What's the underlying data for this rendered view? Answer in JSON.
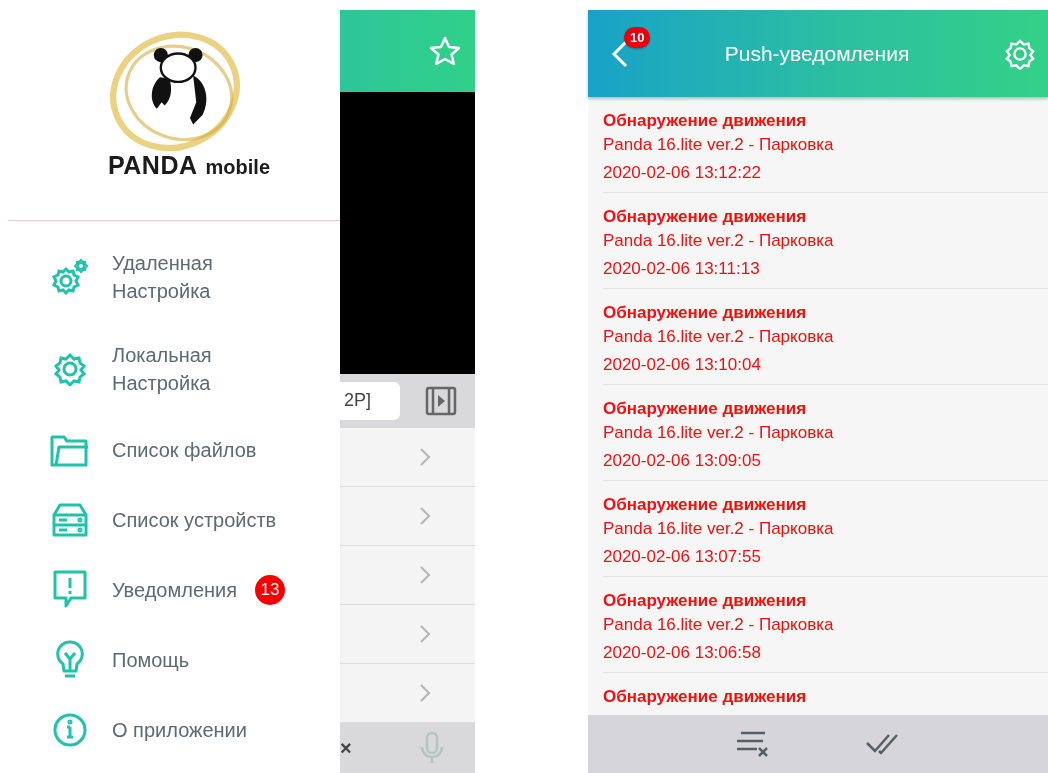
{
  "drawer": {
    "logo": {
      "brand": "PANDA",
      "suffix": "mobile"
    },
    "items": [
      {
        "kind": "remote-settings",
        "label": "Удаленная\nНастройка"
      },
      {
        "kind": "settings",
        "label": "Локальная\nНастройка"
      },
      {
        "kind": "files",
        "label": "Список файлов"
      },
      {
        "kind": "devices",
        "label": "Список устройств"
      },
      {
        "kind": "alerts",
        "label": "Уведомления",
        "badge": "13"
      },
      {
        "kind": "help",
        "label": "Помощь"
      },
      {
        "kind": "about",
        "label": "О приложении"
      }
    ]
  },
  "background_screen": {
    "field_value": "2P]",
    "close_symbol": "×"
  },
  "push_screen": {
    "title": "Push-уведомления",
    "back_badge": "10",
    "notifications": [
      {
        "title": "Обнаружение движения",
        "device": "Panda 16.lite ver.2 - Парковка",
        "time": "2020-02-06 13:12:22"
      },
      {
        "title": "Обнаружение движения",
        "device": "Panda 16.lite ver.2 - Парковка",
        "time": "2020-02-06 13:11:13"
      },
      {
        "title": "Обнаружение движения",
        "device": "Panda 16.lite ver.2 - Парковка",
        "time": "2020-02-06 13:10:04"
      },
      {
        "title": "Обнаружение движения",
        "device": "Panda 16.lite ver.2 - Парковка",
        "time": "2020-02-06 13:09:05"
      },
      {
        "title": "Обнаружение движения",
        "device": "Panda 16.lite ver.2 - Парковка",
        "time": "2020-02-06 13:07:55"
      },
      {
        "title": "Обнаружение движения",
        "device": "Panda 16.lite ver.2 - Парковка",
        "time": "2020-02-06 13:06:58"
      },
      {
        "title": "Обнаружение движения"
      }
    ]
  }
}
